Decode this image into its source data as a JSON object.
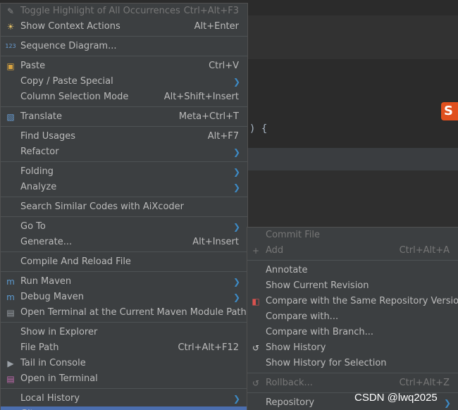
{
  "editor": {
    "code_fragment": ") {"
  },
  "ime_badge": "S",
  "main_menu": [
    {
      "label": "Toggle Highlight of All Occurrences",
      "shortcut": "Ctrl+Alt+F3",
      "icon": "highlight-icon",
      "disabled": true
    },
    {
      "label": "Show Context Actions",
      "shortcut": "Alt+Enter",
      "icon": "lightbulb-icon"
    },
    {
      "sep": true
    },
    {
      "label": "Sequence Diagram...",
      "shortcut": "",
      "icon": "sequence-123-icon"
    },
    {
      "sep": true
    },
    {
      "label": "Paste",
      "shortcut": "Ctrl+V",
      "icon": "clipboard-icon"
    },
    {
      "label": "Copy / Paste Special",
      "shortcut": "",
      "submenu": true
    },
    {
      "label": "Column Selection Mode",
      "shortcut": "Alt+Shift+Insert"
    },
    {
      "sep": true
    },
    {
      "label": "Translate",
      "shortcut": "Meta+Ctrl+T",
      "icon": "translate-icon"
    },
    {
      "sep": true
    },
    {
      "label": "Find Usages",
      "shortcut": "Alt+F7"
    },
    {
      "label": "Refactor",
      "shortcut": "",
      "submenu": true
    },
    {
      "sep": true
    },
    {
      "label": "Folding",
      "shortcut": "",
      "submenu": true
    },
    {
      "label": "Analyze",
      "shortcut": "",
      "submenu": true
    },
    {
      "sep": true
    },
    {
      "label": "Search Similar Codes with AiXcoder",
      "shortcut": ""
    },
    {
      "sep": true
    },
    {
      "label": "Go To",
      "shortcut": "",
      "submenu": true
    },
    {
      "label": "Generate...",
      "shortcut": "Alt+Insert"
    },
    {
      "sep": true
    },
    {
      "label": "Compile And Reload File",
      "shortcut": ""
    },
    {
      "sep": true
    },
    {
      "label": "Run Maven",
      "shortcut": "",
      "icon": "maven-run-icon",
      "submenu": true
    },
    {
      "label": "Debug Maven",
      "shortcut": "",
      "icon": "maven-debug-icon",
      "submenu": true
    },
    {
      "label": "Open Terminal at the Current Maven Module Path",
      "shortcut": "",
      "icon": "maven-terminal-icon"
    },
    {
      "sep": true
    },
    {
      "label": "Show in Explorer",
      "shortcut": ""
    },
    {
      "label": "File Path",
      "shortcut": "Ctrl+Alt+F12"
    },
    {
      "label": "Tail in Console",
      "shortcut": "",
      "icon": "play-icon"
    },
    {
      "label": "Open in Terminal",
      "shortcut": "",
      "icon": "terminal-icon"
    },
    {
      "sep": true
    },
    {
      "label": "Local History",
      "shortcut": "",
      "submenu": true
    },
    {
      "label": "Git",
      "shortcut": "",
      "submenu": true,
      "selected": true
    }
  ],
  "git_submenu": [
    {
      "label": "Commit File",
      "shortcut": "",
      "disabled": true
    },
    {
      "label": "Add",
      "shortcut": "Ctrl+Alt+A",
      "icon": "plus-icon",
      "disabled": true
    },
    {
      "sep": true
    },
    {
      "label": "Annotate",
      "shortcut": ""
    },
    {
      "label": "Show Current Revision",
      "shortcut": ""
    },
    {
      "label": "Compare with the Same Repository Version",
      "shortcut": "",
      "icon": "diff-icon"
    },
    {
      "label": "Compare with...",
      "shortcut": ""
    },
    {
      "label": "Compare with Branch...",
      "shortcut": ""
    },
    {
      "label": "Show History",
      "shortcut": "",
      "icon": "history-icon"
    },
    {
      "label": "Show History for Selection",
      "shortcut": ""
    },
    {
      "sep": true
    },
    {
      "label": "Rollback...",
      "shortcut": "Ctrl+Alt+Z",
      "icon": "rollback-icon",
      "disabled": true
    },
    {
      "sep": true
    },
    {
      "label": "Repository",
      "shortcut": "",
      "submenu": true
    }
  ],
  "watermark": "CSDN @lwq2025"
}
